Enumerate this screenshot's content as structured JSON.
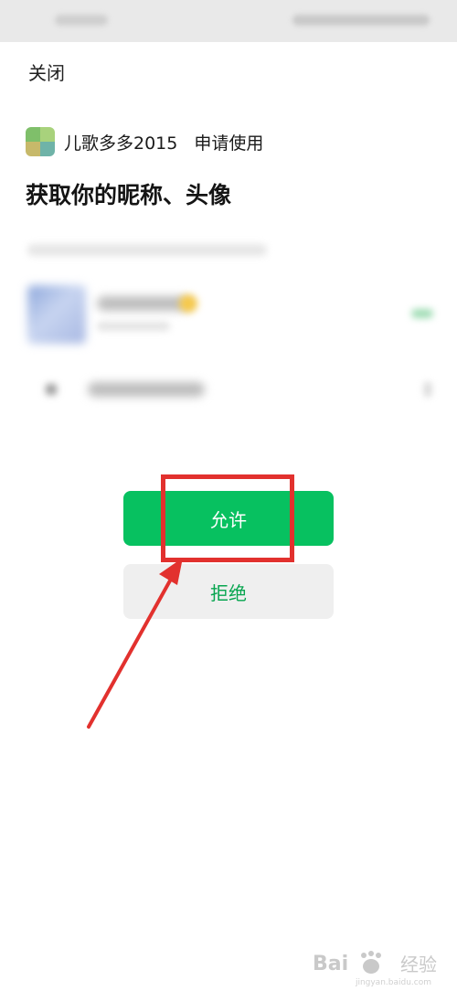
{
  "close": {
    "label": "关闭"
  },
  "app": {
    "name": "儿歌多多2015",
    "request_text": "申请使用"
  },
  "scope": {
    "title": "获取你的昵称、头像"
  },
  "actions": {
    "allow_label": "允许",
    "deny_label": "拒绝"
  },
  "watermark": {
    "brand": "Bai",
    "brand_suffix": "经验",
    "url": "jingyan.baidu.com"
  },
  "colors": {
    "primary_green": "#07c160",
    "deny_text_green": "#07a54f",
    "annotation_red": "#e2312e"
  },
  "annotation": {
    "type": "red box with arrow pointing to allow button"
  }
}
